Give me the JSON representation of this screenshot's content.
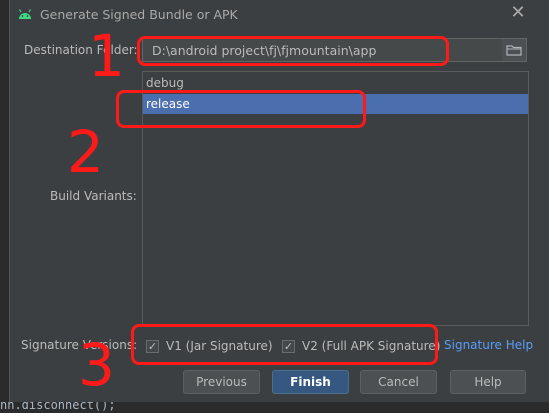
{
  "window": {
    "title": "Generate Signed Bundle or APK"
  },
  "form": {
    "destination_label": "Destination Folder:",
    "destination_value": "D:\\android project\\fj\\fjmountain\\app",
    "build_variants_label": "Build Variants:",
    "signature_label": "Signature Versions:"
  },
  "variants": [
    "debug",
    "release"
  ],
  "signature": {
    "v1_label": "V1 (Jar Signature)",
    "v1_checked": true,
    "v2_label": "V2 (Full APK Signature)",
    "v2_checked": true,
    "help_link": "Signature Help"
  },
  "buttons": {
    "previous": "Previous",
    "finish": "Finish",
    "cancel": "Cancel",
    "help": "Help"
  },
  "background_code": "nn.disconnect();",
  "annotations": [
    "1",
    "2",
    "3"
  ],
  "colors": {
    "dialog_bg": "#3c3f41",
    "selection": "#4b6eaf",
    "primary_button": "#365880",
    "link": "#589df6",
    "annotation": "#ff1a1a"
  }
}
